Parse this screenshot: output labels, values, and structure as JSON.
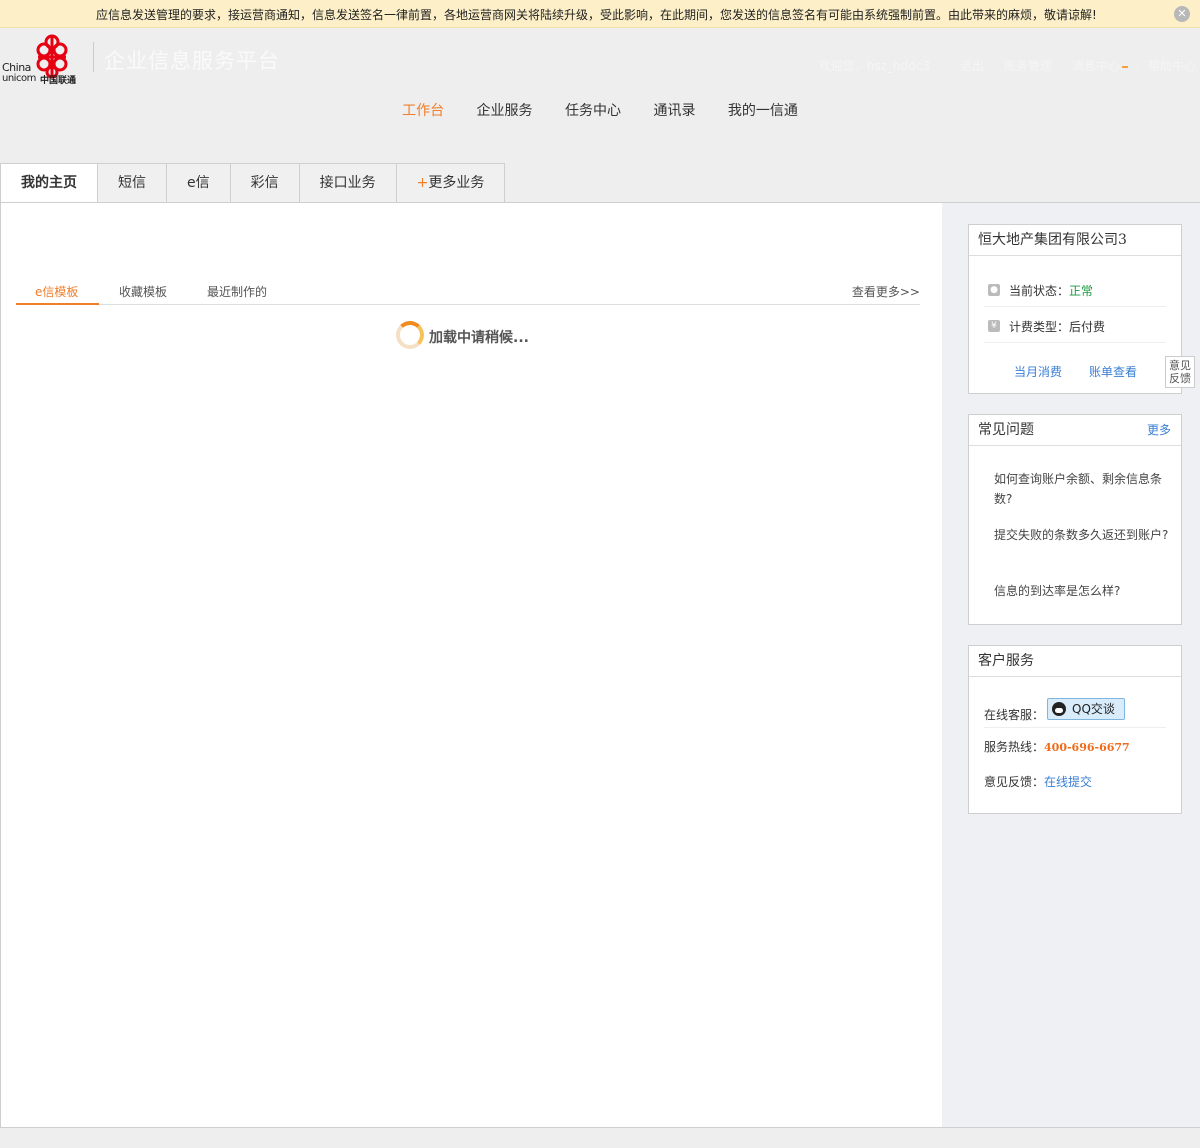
{
  "notice": {
    "text": "应信息发送管理的要求，接运营商通知，信息发送签名一律前置，各地运营商网关将陆续升级，受此影响，在此期间，您发送的信息签名有可能由系统强制前置。由此带来的麻烦，敬请谅解!",
    "close_label": "✕"
  },
  "header": {
    "logo_en_1": "China",
    "logo_en_2": "unicom",
    "logo_cn": "中国联通",
    "platform_title": "企业信息服务平台",
    "welcome": "欢迎您，hsz_hddc3",
    "links": [
      "退出",
      "账务管理",
      "消息中心",
      "帮助中心"
    ]
  },
  "main_nav": [
    "工作台",
    "企业服务",
    "任务中心",
    "通讯录",
    "我的一信通"
  ],
  "tabs": {
    "items": [
      "我的主页",
      "短信",
      "e信",
      "彩信",
      "接口业务"
    ],
    "more_plus": "+",
    "more_label": "更多业务"
  },
  "subtabs": {
    "items": [
      "e信模板",
      "收藏模板",
      "最近制作的"
    ],
    "more": "查看更多>>"
  },
  "loading_text": "加载中请稍候...",
  "account_card": {
    "company": "恒大地产集团有限公司3",
    "status_label": "当前状态：",
    "status_value": "正常",
    "billing_label": "计费类型：",
    "billing_value": "后付费",
    "link_monthly": "当月消费",
    "link_bill": "账单查看"
  },
  "feedback_tab": {
    "line1": "意见",
    "line2": "反馈"
  },
  "faq_card": {
    "title": "常见问题",
    "more": "更多",
    "items": [
      "如何查询账户余额、剩余信息条数?",
      "提交失败的条数多久返还到账户?",
      "信息的到达率是怎么样?"
    ]
  },
  "service_card": {
    "title": "客户服务",
    "online_label": "在线客服：",
    "qq_label": "QQ交谈",
    "hotline_label": "服务热线：",
    "hotline_value": "400-696-6677",
    "feedback_label": "意见反馈：",
    "feedback_link": "在线提交"
  },
  "colors": {
    "accent": "#f07e2a",
    "link": "#3a7fd5",
    "notice_bg": "#fdf0c8",
    "logo_red": "#e60012"
  }
}
